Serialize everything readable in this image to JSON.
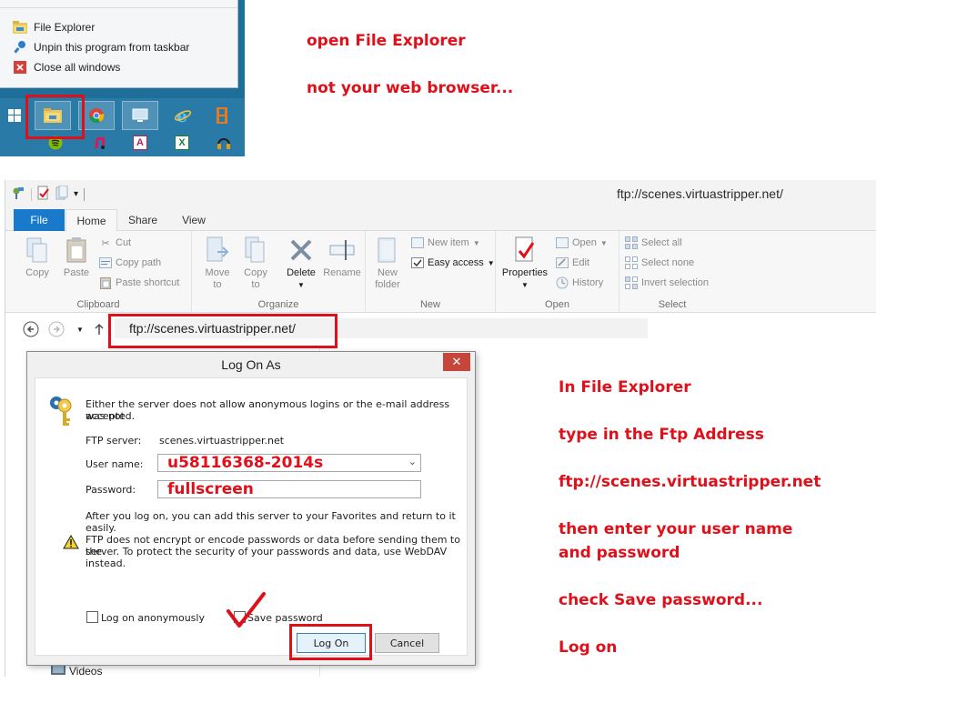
{
  "jumplist": {
    "items": [
      {
        "label": "File Explorer",
        "icon": "folder-icon"
      },
      {
        "label": "Unpin this program from taskbar",
        "icon": "unpin-icon"
      },
      {
        "label": "Close all windows",
        "icon": "close-icon"
      }
    ]
  },
  "annotations": {
    "top1": "open File Explorer",
    "top2": "not your web browser...",
    "right1": "In File Explorer",
    "right2": "type in the Ftp Address",
    "right3": "ftp://scenes.virtuastripper.net",
    "right4a": "then enter your user name",
    "right4b": "and password",
    "right5": "check Save password...",
    "right6": "Log on",
    "accent_color": "#e0101a"
  },
  "explorer": {
    "window_title": "ftp://scenes.virtuastripper.net/",
    "tabs": {
      "file": "File",
      "home": "Home",
      "share": "Share",
      "view": "View"
    },
    "ribbon": {
      "clipboard": {
        "label": "Clipboard",
        "copy": "Copy",
        "paste": "Paste",
        "cut": "Cut",
        "copy_path": "Copy path",
        "paste_shortcut": "Paste shortcut"
      },
      "organize": {
        "label": "Organize",
        "move_to": "Move",
        "move_to2": "to",
        "copy_to": "Copy",
        "copy_to2": "to",
        "delete": "Delete",
        "rename": "Rename"
      },
      "new": {
        "label": "New",
        "new_folder": "New",
        "new_folder2": "folder",
        "new_item": "New item",
        "easy_access": "Easy access"
      },
      "open": {
        "label": "Open",
        "properties": "Properties",
        "open": "Open",
        "edit": "Edit",
        "history": "History"
      },
      "select": {
        "label": "Select",
        "select_all": "Select all",
        "select_none": "Select none",
        "invert_selection": "Invert selection"
      }
    },
    "address": "ftp://scenes.virtuastripper.net/",
    "nav_item": "Videos"
  },
  "dialog": {
    "title": "Log On As",
    "close_glyph": "✕",
    "intro": "Either the server does not allow anonymous logins or the e-mail address was not accepted.",
    "intro_line1": "Either the server does not allow anonymous logins or the e-mail address was not",
    "intro_line2": "accepted.",
    "ftp_server_label": "FTP server:",
    "ftp_server_value": "scenes.virtuastripper.net",
    "username_label": "User name:",
    "username_value": "u58116368-2014s",
    "password_label": "Password:",
    "password_value": "fullscreen",
    "favorites_note": "After you log on, you can add this server to your Favorites and return to it easily.",
    "warning_line1": "FTP does not encrypt or encode passwords or data before sending them to the",
    "warning_line2": "server.  To protect the security of your passwords and data, use WebDAV instead.",
    "anonymous_label": "Log on anonymously",
    "save_password_label": "Save password",
    "logon_button": "Log On",
    "cancel_button": "Cancel"
  }
}
